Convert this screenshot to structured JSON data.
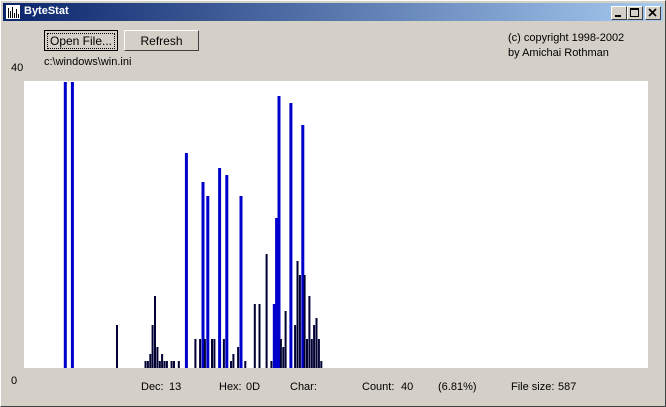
{
  "window": {
    "title": "ByteStat",
    "icon": "bar-chart-icon",
    "controls": [
      "minimize-icon",
      "maximize-icon",
      "close-icon"
    ]
  },
  "toolbar": {
    "open_label": "Open File...",
    "refresh_label": "Refresh"
  },
  "file_path": "c:\\windows\\win.ini",
  "copyright": {
    "line1": "(c) copyright 1998-2002",
    "line2": "by Amichai Rothman"
  },
  "status": {
    "dec_label": "Dec:",
    "dec_value": "13",
    "hex_label": "Hex:",
    "hex_value": "0D",
    "char_label": "Char:",
    "count_label": "Count:",
    "count_value": "40",
    "percent": "(6.81%)",
    "filesize_label": "File size:",
    "filesize_value": "587"
  },
  "colors": {
    "highlight_bar": "#0000cc",
    "normal_bar": "#000033",
    "chart_bg": "#ffffff",
    "title_start": "#0a246a",
    "title_end": "#a6caf0"
  },
  "chart_data": {
    "type": "bar",
    "ylim": [
      0,
      40
    ],
    "ytick_labels": [
      "40",
      "0"
    ],
    "xlim": [
      0,
      255
    ],
    "bars": [
      {
        "byte": 10,
        "value": 40,
        "highlight": true
      },
      {
        "byte": 13,
        "value": 40,
        "highlight": true
      },
      {
        "byte": 32,
        "value": 6,
        "highlight": false
      },
      {
        "byte": 44,
        "value": 1,
        "highlight": false
      },
      {
        "byte": 45,
        "value": 1,
        "highlight": false
      },
      {
        "byte": 46,
        "value": 2,
        "highlight": false
      },
      {
        "byte": 47,
        "value": 6,
        "highlight": false
      },
      {
        "byte": 48,
        "value": 10,
        "highlight": false
      },
      {
        "byte": 49,
        "value": 3,
        "highlight": false
      },
      {
        "byte": 50,
        "value": 1,
        "highlight": false
      },
      {
        "byte": 51,
        "value": 2,
        "highlight": false
      },
      {
        "byte": 52,
        "value": 1,
        "highlight": false
      },
      {
        "byte": 53,
        "value": 1,
        "highlight": false
      },
      {
        "byte": 55,
        "value": 1,
        "highlight": false
      },
      {
        "byte": 56,
        "value": 1,
        "highlight": false
      },
      {
        "byte": 58,
        "value": 1,
        "highlight": false
      },
      {
        "byte": 61,
        "value": 30,
        "highlight": true
      },
      {
        "byte": 65,
        "value": 4,
        "highlight": false
      },
      {
        "byte": 67,
        "value": 4,
        "highlight": false
      },
      {
        "byte": 68,
        "value": 26,
        "highlight": true
      },
      {
        "byte": 69,
        "value": 4,
        "highlight": false
      },
      {
        "byte": 70,
        "value": 24,
        "highlight": true
      },
      {
        "byte": 72,
        "value": 4,
        "highlight": false
      },
      {
        "byte": 73,
        "value": 4,
        "highlight": false
      },
      {
        "byte": 75,
        "value": 28,
        "highlight": true
      },
      {
        "byte": 77,
        "value": 4,
        "highlight": false
      },
      {
        "byte": 78,
        "value": 27,
        "highlight": true
      },
      {
        "byte": 80,
        "value": 1,
        "highlight": false
      },
      {
        "byte": 81,
        "value": 2,
        "highlight": false
      },
      {
        "byte": 83,
        "value": 3,
        "highlight": false
      },
      {
        "byte": 84,
        "value": 24,
        "highlight": true
      },
      {
        "byte": 86,
        "value": 1,
        "highlight": false
      },
      {
        "byte": 90,
        "value": 9,
        "highlight": false
      },
      {
        "byte": 92,
        "value": 9,
        "highlight": false
      },
      {
        "byte": 95,
        "value": 16,
        "highlight": false
      },
      {
        "byte": 97,
        "value": 1,
        "highlight": false
      },
      {
        "byte": 98,
        "value": 9,
        "highlight": true
      },
      {
        "byte": 99,
        "value": 21,
        "highlight": true
      },
      {
        "byte": 100,
        "value": 38,
        "highlight": true
      },
      {
        "byte": 101,
        "value": 4,
        "highlight": false
      },
      {
        "byte": 102,
        "value": 3,
        "highlight": false
      },
      {
        "byte": 103,
        "value": 8,
        "highlight": false
      },
      {
        "byte": 105,
        "value": 37,
        "highlight": true
      },
      {
        "byte": 107,
        "value": 6,
        "highlight": false
      },
      {
        "byte": 108,
        "value": 15,
        "highlight": false
      },
      {
        "byte": 109,
        "value": 13,
        "highlight": false
      },
      {
        "byte": 110,
        "value": 34,
        "highlight": true
      },
      {
        "byte": 111,
        "value": 13,
        "highlight": false
      },
      {
        "byte": 112,
        "value": 4,
        "highlight": false
      },
      {
        "byte": 113,
        "value": 10,
        "highlight": false
      },
      {
        "byte": 114,
        "value": 4,
        "highlight": false
      },
      {
        "byte": 115,
        "value": 6,
        "highlight": false
      },
      {
        "byte": 116,
        "value": 7,
        "highlight": false
      },
      {
        "byte": 117,
        "value": 4,
        "highlight": false
      },
      {
        "byte": 118,
        "value": 1,
        "highlight": false
      }
    ]
  }
}
